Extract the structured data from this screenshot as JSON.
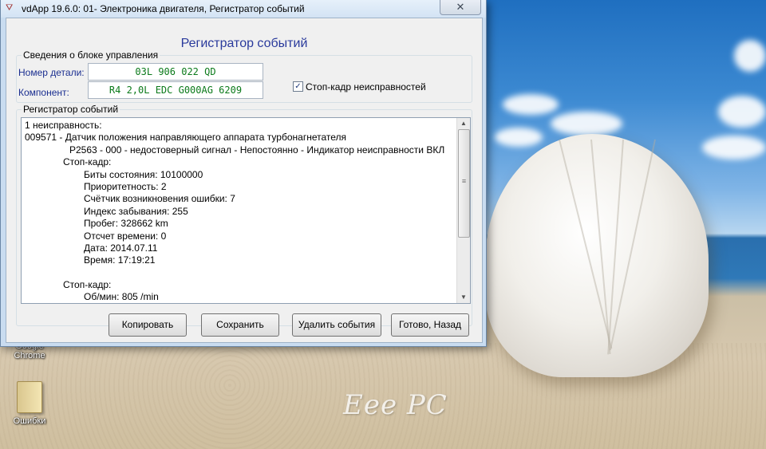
{
  "window": {
    "title": "vdApp 19.6.0: 01- Электроника двигателя,  Регистратор событий",
    "close_glyph": "✕",
    "app_icon": "valve-icon"
  },
  "dialog": {
    "heading": "Регистратор событий"
  },
  "control_unit": {
    "group_label": "Сведения о блоке управления",
    "part_number_label": "Номер детали:",
    "part_number_value": "03L 906 022 QD",
    "component_label": "Компонент:",
    "component_value": "R4 2,0L EDC G000AG  6209",
    "freeze_frame_checkbox_label": "Стоп-кадр неисправностей",
    "freeze_frame_checked": true
  },
  "event_log": {
    "group_label": "Регистратор событий",
    "lines": [
      {
        "text": "1 неисправность:",
        "indent": 0
      },
      {
        "text": "009571 - Датчик положения направляющего аппарата турбонагнетателя",
        "indent": 0
      },
      {
        "text": "P2563 - 000 - недостоверный сигнал - Непостоянно - Индикатор неисправности ВКЛ",
        "indent": 1
      },
      {
        "text": "Стоп-кадр:",
        "indent": 2
      },
      {
        "text": "Биты состояния: 10100000",
        "indent": 3
      },
      {
        "text": "Приоритетность: 2",
        "indent": 3
      },
      {
        "text": "Счётчик возникновения ошибки: 7",
        "indent": 3
      },
      {
        "text": "Индекс забывания: 255",
        "indent": 3
      },
      {
        "text": "Пробег: 328662 km",
        "indent": 3
      },
      {
        "text": "Отсчет времени: 0",
        "indent": 3
      },
      {
        "text": "Дата: 2014.07.11",
        "indent": 3
      },
      {
        "text": "Время: 17:19:21",
        "indent": 3
      },
      {
        "text": "",
        "indent": 0
      },
      {
        "text": "Стоп-кадр:",
        "indent": 2
      },
      {
        "text": "Об/мин: 805 /min",
        "indent": 3
      }
    ]
  },
  "buttons": {
    "copy": "Копировать",
    "save": "Сохранить",
    "delete_events": "Удалить события",
    "done_back": "Готово, Назад"
  },
  "desktop": {
    "icons": [
      {
        "label_line1": "Google",
        "label_line2": "Chrome",
        "icon": "chrome-icon"
      },
      {
        "label_line1": "Ошибки",
        "label_line2": "",
        "icon": "folder-icon"
      }
    ],
    "logo_text": "Eee PC"
  },
  "colors": {
    "heading": "#2a3a9c",
    "field_label": "#1a2e90",
    "field_value": "#0b7a1a"
  }
}
